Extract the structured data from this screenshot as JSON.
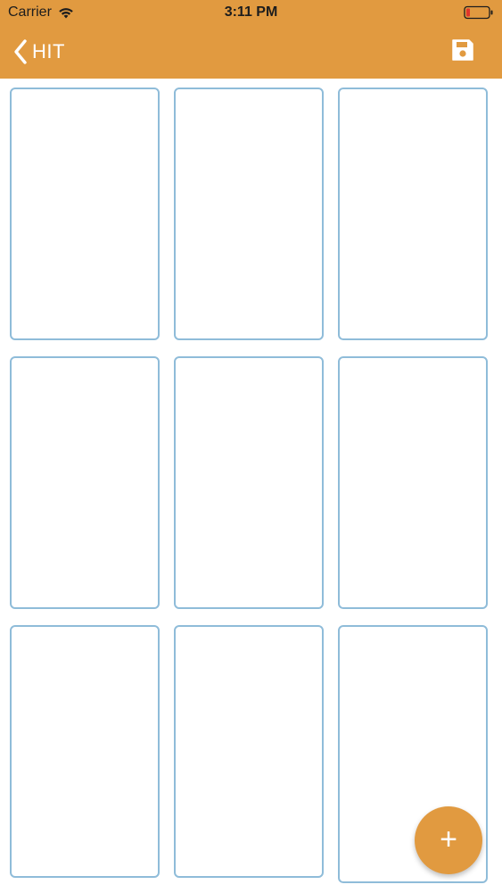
{
  "status_bar": {
    "carrier": "Carrier",
    "time": "3:11 PM",
    "wifi_icon": "wifi-icon",
    "battery_icon": "battery-low-icon"
  },
  "nav": {
    "back_label": "HIT",
    "back_icon": "chevron-left-icon",
    "save_icon": "floppy-disk-icon"
  },
  "grid": {
    "columns": 3,
    "rows": 3,
    "card_count": 9
  },
  "fab": {
    "label": "+",
    "icon": "plus-icon"
  },
  "colors": {
    "accent": "#e19a40",
    "card_border": "#8fbcd9",
    "background": "#ffffff"
  }
}
